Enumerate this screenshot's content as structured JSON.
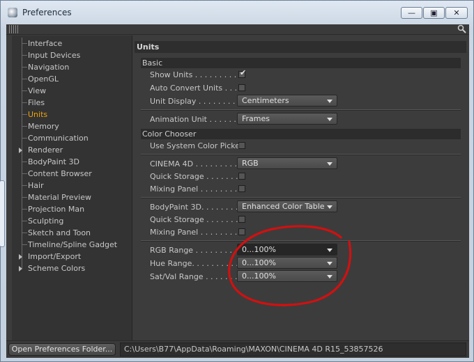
{
  "window": {
    "title": "Preferences",
    "min_glyph": "—",
    "max_glyph": "▣",
    "close_glyph": "✕"
  },
  "sidebar": {
    "items": [
      {
        "label": "Interface",
        "expandable": false,
        "selected": false
      },
      {
        "label": "Input Devices",
        "expandable": false,
        "selected": false
      },
      {
        "label": "Navigation",
        "expandable": false,
        "selected": false
      },
      {
        "label": "OpenGL",
        "expandable": false,
        "selected": false
      },
      {
        "label": "View",
        "expandable": false,
        "selected": false
      },
      {
        "label": "Files",
        "expandable": false,
        "selected": false
      },
      {
        "label": "Units",
        "expandable": false,
        "selected": true
      },
      {
        "label": "Memory",
        "expandable": false,
        "selected": false
      },
      {
        "label": "Communication",
        "expandable": false,
        "selected": false
      },
      {
        "label": "Renderer",
        "expandable": true,
        "selected": false
      },
      {
        "label": "BodyPaint 3D",
        "expandable": false,
        "selected": false
      },
      {
        "label": "Content Browser",
        "expandable": false,
        "selected": false
      },
      {
        "label": "Hair",
        "expandable": false,
        "selected": false
      },
      {
        "label": "Material Preview",
        "expandable": false,
        "selected": false
      },
      {
        "label": "Projection Man",
        "expandable": false,
        "selected": false
      },
      {
        "label": "Sculpting",
        "expandable": false,
        "selected": false
      },
      {
        "label": "Sketch and Toon",
        "expandable": false,
        "selected": false
      },
      {
        "label": "Timeline/Spline Gadget",
        "expandable": false,
        "selected": false
      },
      {
        "label": "Import/Export",
        "expandable": true,
        "selected": false
      },
      {
        "label": "Scheme Colors",
        "expandable": true,
        "selected": false
      }
    ]
  },
  "content": {
    "title": "Units",
    "basic": {
      "header": "Basic",
      "show_units": {
        "label": "Show Units . . . . . . . . . .",
        "checked": true
      },
      "auto_convert": {
        "label": "Auto Convert Units . . . .",
        "checked": false
      },
      "unit_display": {
        "label": "Unit Display . . . . . . . . .",
        "value": "Centimeters"
      },
      "animation_unit": {
        "label": "Animation Unit . . . . . . .",
        "value": "Frames"
      }
    },
    "color_chooser": {
      "header": "Color Chooser",
      "system_picker": {
        "label": "Use System Color Picker",
        "checked": false
      },
      "cinema4d": {
        "label": "CINEMA 4D . . . . . . . . . .",
        "value": "RGB"
      },
      "quick_storage_1": {
        "label": "Quick Storage . . . . . . . .",
        "checked": false
      },
      "mixing_panel_1": {
        "label": "Mixing Panel . . . . . . . . .",
        "checked": false
      },
      "bodypaint": {
        "label": "BodyPaint 3D. . . . . . . . . .",
        "value": "Enhanced Color Table"
      },
      "quick_storage_2": {
        "label": "Quick Storage . . . . . . . .",
        "checked": false
      },
      "mixing_panel_2": {
        "label": "Mixing Panel . . . . . . . . .",
        "checked": false
      },
      "rgb_range": {
        "label": "RGB Range . . . . . . . . . . .",
        "value": "0...100%"
      },
      "hue_range": {
        "label": "Hue Range. . . . . . . . . . . .",
        "value": "0...100%"
      },
      "satval_range": {
        "label": "Sat/Val Range . . . . . . . . .",
        "value": "0...100%"
      }
    }
  },
  "footer": {
    "open_folder_label": "Open Preferences Folder...",
    "path": "C:\\Users\\B77\\AppData\\Roaming\\MAXON\\CINEMA 4D R15_53857526"
  },
  "colors": {
    "selected_item": "#f0a30a",
    "annotation": "#d21010"
  }
}
